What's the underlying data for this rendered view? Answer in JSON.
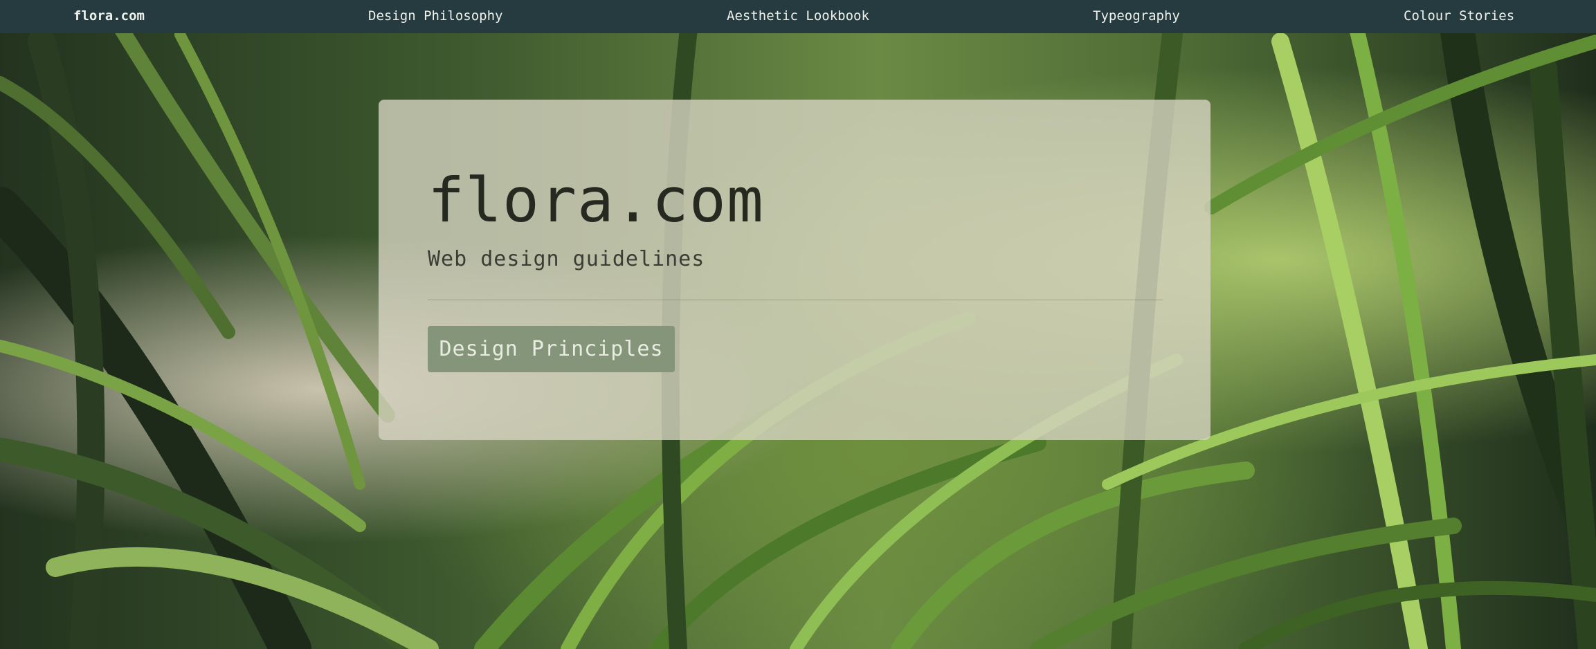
{
  "nav": {
    "brand": "flora.com",
    "links": [
      {
        "label": "Design Philosophy"
      },
      {
        "label": "Aesthetic Lookbook"
      },
      {
        "label": "Typeogra​phy"
      },
      {
        "label": "Colour Stories"
      }
    ]
  },
  "hero": {
    "title": "flora.com",
    "subtitle": "Web design guidelines",
    "cta_label": "Design Principles"
  },
  "colors": {
    "nav_background": "#253b3f",
    "nav_text": "#eef1ec",
    "card_background": "#d6d3c0",
    "title_text": "#25291f",
    "button_background": "#84957a",
    "button_text": "#e9ece0"
  },
  "background": {
    "image_subject": "palm-leaves-photo"
  }
}
